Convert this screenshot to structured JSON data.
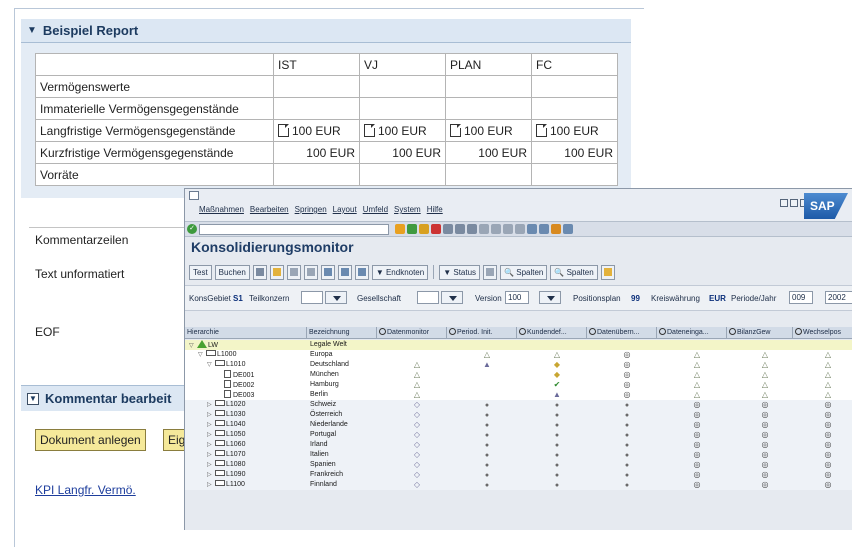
{
  "report": {
    "header_title": "Beispiel Report",
    "table": {
      "columns": [
        "IST",
        "VJ",
        "PLAN",
        "FC"
      ],
      "rows": [
        {
          "label": "Vermögenswerte",
          "values": [
            "",
            "",
            "",
            ""
          ],
          "icon": false
        },
        {
          "label": "Immaterielle Vermögensgegenstände",
          "values": [
            "",
            "",
            "",
            ""
          ],
          "icon": false
        },
        {
          "label": "Langfristige Vermögensgegenstände",
          "values": [
            "100 EUR",
            "100 EUR",
            "100 EUR",
            "100 EUR"
          ],
          "icon": true
        },
        {
          "label": "Kurzfristige Vermögensgegenstände",
          "values": [
            "100 EUR",
            "100 EUR",
            "100 EUR",
            "100 EUR"
          ],
          "icon": false
        },
        {
          "label": "Vorräte",
          "values": [
            "",
            "",
            "",
            ""
          ],
          "icon": false
        }
      ]
    },
    "comments": {
      "row1": "Kommentarzeilen",
      "row2": "Text unformatiert",
      "row3": "EOF"
    },
    "comment_edit_title": "Kommentar bearbeit",
    "buttons": {
      "create_doc": "Dokument anlegen",
      "eig": "Eig"
    },
    "kpi_link": "KPI Langfr. Vermö."
  },
  "sap": {
    "menu": [
      "Maßnahmen",
      "Bearbeiten",
      "Springen",
      "Layout",
      "Umfeld",
      "System",
      "Hilfe"
    ],
    "logo": "SAP",
    "title": "Konsolidierungsmonitor",
    "toolbar": {
      "test": "Test",
      "buchen": "Buchen",
      "endknoten": "Endknoten",
      "status": "Status",
      "spalten1": "Spalten",
      "spalten2": "Spalten"
    },
    "selection": {
      "konsgebiet_label": "KonsGebiet",
      "konsgebiet_value": "S1",
      "teilkonzern_label": "Teilkonzern",
      "gesellschaft_label": "Gesellschaft",
      "version_label": "Version",
      "version_value": "100",
      "positionsplan_label": "Positionsplan",
      "positionsplan_value": "99",
      "kreiswaehrung_label": "Kreiswährung",
      "kreiswaehrung_value": "EUR",
      "periode_label": "Periode/Jahr",
      "periode_value": "009",
      "jahr_value": "2002"
    },
    "tree_columns": [
      "Hierarchie",
      "Bezeichnung",
      "Datenmonitor",
      "Period. Init.",
      "Kundendef...",
      "Datenübern...",
      "Dateneinga...",
      "BilanzGew",
      "Wechselpos"
    ],
    "tree_rows": [
      {
        "node": "LW",
        "name": "Legale Welt",
        "level": 0,
        "kind": "root",
        "status": [
          "",
          "",
          "",
          "",
          "",
          "",
          ""
        ]
      },
      {
        "node": "L1000",
        "name": "Europa",
        "level": 1,
        "kind": "folder",
        "status": [
          "",
          "tri",
          "tri",
          "circ",
          "tri",
          "tri",
          "tri"
        ]
      },
      {
        "node": "L1010",
        "name": "Deutschland",
        "level": 2,
        "kind": "folder",
        "status": [
          "tri",
          "lock",
          "flag",
          "circ",
          "tri",
          "tri",
          "tri"
        ]
      },
      {
        "node": "DE001",
        "name": "München",
        "level": 3,
        "kind": "doc",
        "status": [
          "tri",
          "",
          "flag",
          "circ",
          "tri",
          "tri",
          "tri"
        ]
      },
      {
        "node": "DE002",
        "name": "Hamburg",
        "level": 3,
        "kind": "doc",
        "status": [
          "tri",
          "",
          "chk",
          "circ",
          "tri",
          "tri",
          "tri"
        ]
      },
      {
        "node": "DE003",
        "name": "Berlin",
        "level": 3,
        "kind": "doc",
        "status": [
          "tri",
          "",
          "lock",
          "circ",
          "tri",
          "tri",
          "tri"
        ]
      },
      {
        "node": "L1020",
        "name": "Schweiz",
        "level": 2,
        "kind": "folder",
        "status": [
          "dia",
          "dot",
          "dot",
          "dot",
          "circ",
          "circ",
          "circ"
        ]
      },
      {
        "node": "L1030",
        "name": "Österreich",
        "level": 2,
        "kind": "folder",
        "status": [
          "dia",
          "dot",
          "dot",
          "dot",
          "circ",
          "circ",
          "circ"
        ]
      },
      {
        "node": "L1040",
        "name": "Niederlande",
        "level": 2,
        "kind": "folder",
        "status": [
          "dia",
          "dot",
          "dot",
          "dot",
          "circ",
          "circ",
          "circ"
        ]
      },
      {
        "node": "L1050",
        "name": "Portugal",
        "level": 2,
        "kind": "folder",
        "status": [
          "dia",
          "dot",
          "dot",
          "dot",
          "circ",
          "circ",
          "circ"
        ]
      },
      {
        "node": "L1060",
        "name": "Irland",
        "level": 2,
        "kind": "folder",
        "status": [
          "dia",
          "dot",
          "dot",
          "dot",
          "circ",
          "circ",
          "circ"
        ]
      },
      {
        "node": "L1070",
        "name": "Italien",
        "level": 2,
        "kind": "folder",
        "status": [
          "dia",
          "dot",
          "dot",
          "dot",
          "circ",
          "circ",
          "circ"
        ]
      },
      {
        "node": "L1080",
        "name": "Spanien",
        "level": 2,
        "kind": "folder",
        "status": [
          "dia",
          "dot",
          "dot",
          "dot",
          "circ",
          "circ",
          "circ"
        ]
      },
      {
        "node": "L1090",
        "name": "Frankreich",
        "level": 2,
        "kind": "folder",
        "status": [
          "dia",
          "dot",
          "dot",
          "dot",
          "circ",
          "circ",
          "circ"
        ]
      },
      {
        "node": "L1100",
        "name": "Finnland",
        "level": 2,
        "kind": "folder",
        "status": [
          "dia",
          "dot",
          "dot",
          "dot",
          "circ",
          "circ",
          "circ"
        ]
      }
    ]
  }
}
